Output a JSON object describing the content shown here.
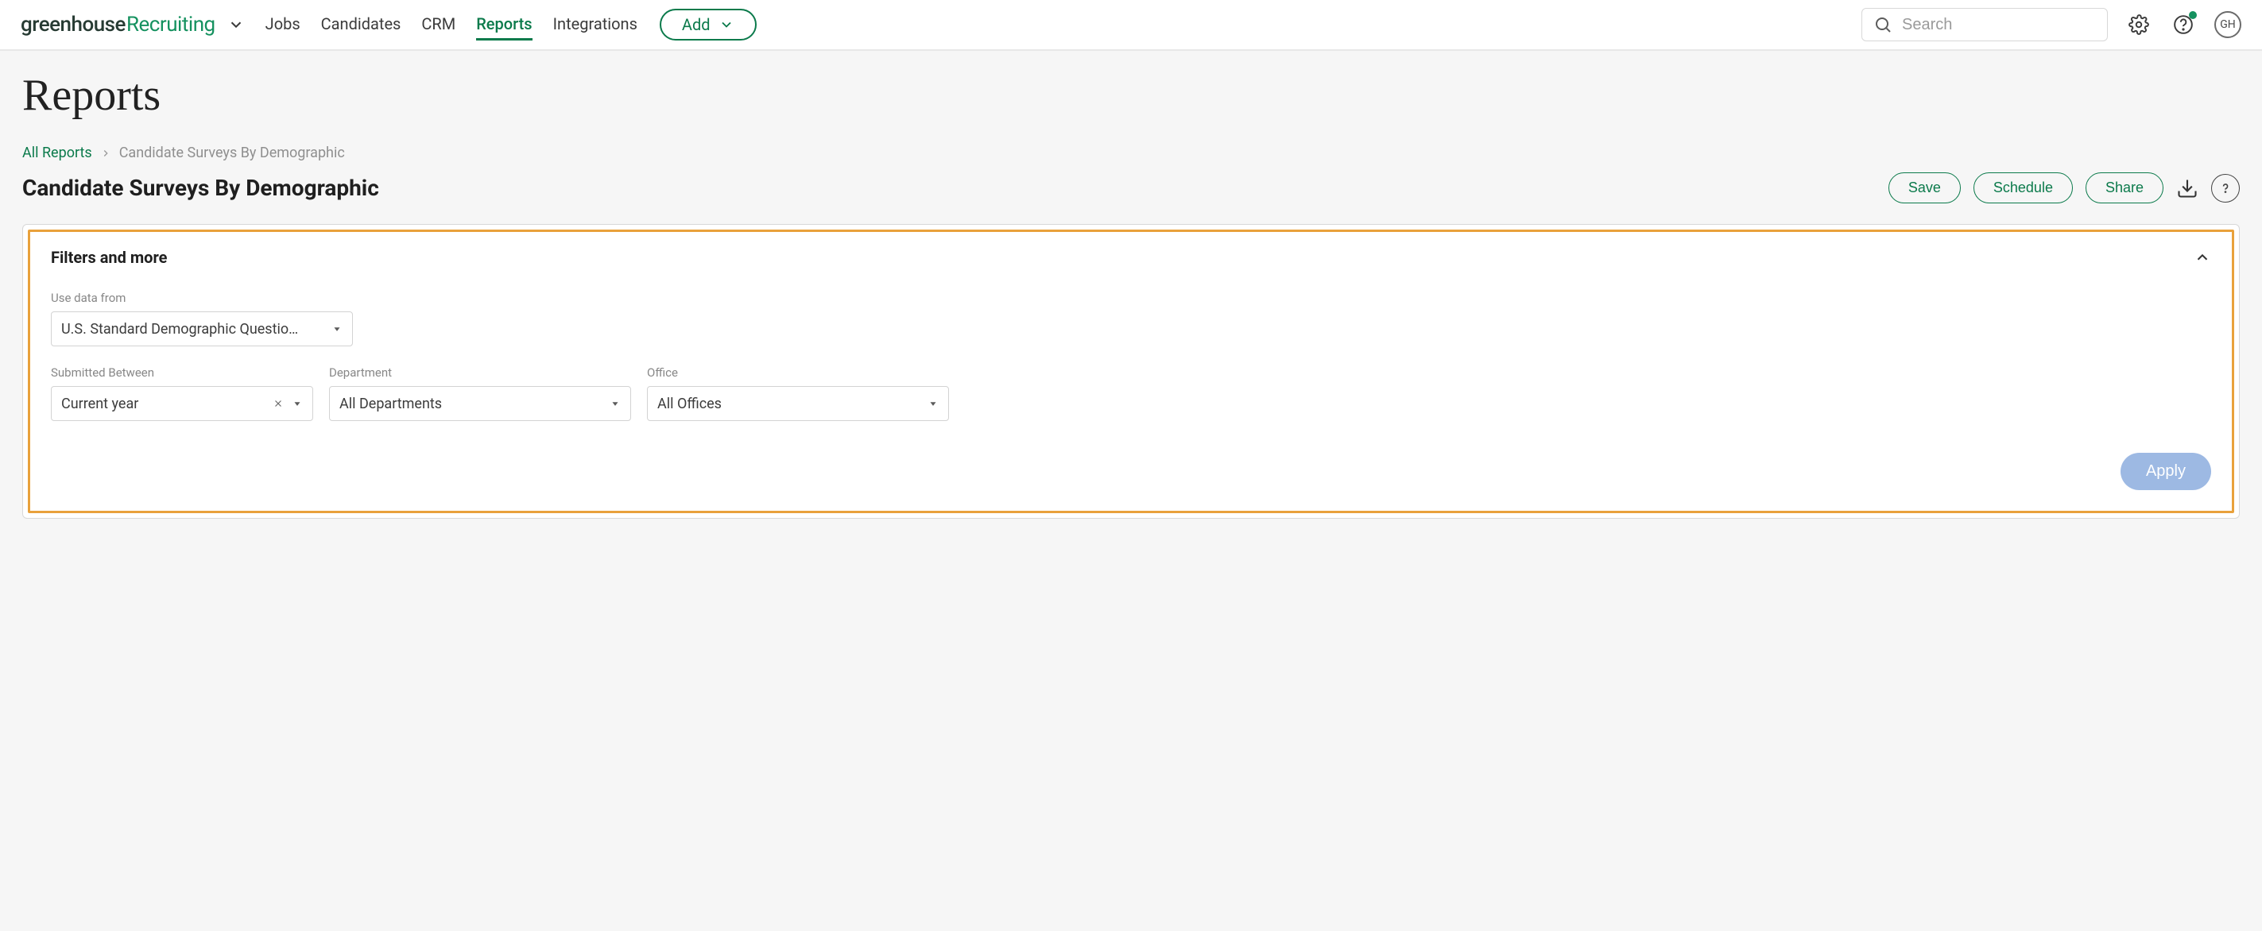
{
  "brand": {
    "part1": "greenhouse",
    "part2": " Recruiting"
  },
  "nav": {
    "jobs": "Jobs",
    "candidates": "Candidates",
    "crm": "CRM",
    "reports": "Reports",
    "integrations": "Integrations",
    "add": "Add"
  },
  "search": {
    "placeholder": "Search"
  },
  "avatar_initials": "GH",
  "page": {
    "title": "Reports",
    "breadcrumb_root": "All Reports",
    "breadcrumb_current": "Candidate Surveys By Demographic",
    "heading": "Candidate Surveys By Demographic"
  },
  "actions": {
    "save": "Save",
    "schedule": "Schedule",
    "share": "Share"
  },
  "filters": {
    "panel_title": "Filters and more",
    "use_data_from_label": "Use data from",
    "use_data_from_value": "U.S. Standard Demographic Questio…",
    "submitted_label": "Submitted Between",
    "submitted_value": "Current year",
    "department_label": "Department",
    "department_value": "All Departments",
    "office_label": "Office",
    "office_value": "All Offices",
    "apply": "Apply"
  }
}
